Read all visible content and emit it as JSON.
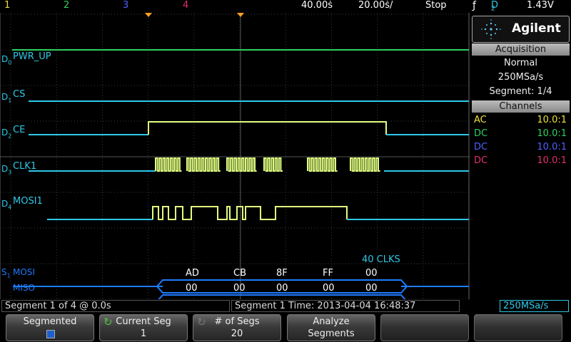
{
  "topbar": {
    "ch1": "1",
    "ch2": "2",
    "ch3": "3",
    "ch4": "4",
    "timebase": "40.00ṡ",
    "delay": "20.00ṡ/",
    "run_state": "Stop",
    "trigger_icon": "trigger-edge-icon",
    "trigger_source": "D",
    "trigger_source_sub": "2",
    "trigger_level": "1.43V"
  },
  "colors": {
    "ch1": "#f0e040",
    "ch2": "#30d060",
    "ch3": "#5060ff",
    "ch4": "#e03070",
    "digital": "#30c8e8",
    "high": "#e0ff80",
    "grid": "#404040",
    "serial": "#1e7cff",
    "orange": "#ffa020"
  },
  "channels": [
    {
      "id": "D",
      "sub": "0",
      "name": "PWR_UP"
    },
    {
      "id": "D",
      "sub": "1",
      "name": "CS"
    },
    {
      "id": "D",
      "sub": "2",
      "name": "CE"
    },
    {
      "id": "D",
      "sub": "3",
      "name": "CLK1"
    },
    {
      "id": "D",
      "sub": "4",
      "name": "MOSI1"
    }
  ],
  "serial": {
    "id": "S",
    "sub": "1",
    "annotation": "40 CLKS",
    "mosi_label": "MOSI",
    "miso_label": "MISO",
    "mosi_bytes": [
      "AD",
      "CB",
      "8F",
      "FF",
      "00"
    ],
    "miso_bytes": [
      "00",
      "00",
      "00",
      "00",
      "00"
    ]
  },
  "panel": {
    "brand": "Agilent",
    "acquisition_header": "Acquisition",
    "mode": "Normal",
    "sample_rate": "250MSa/s",
    "segment": "Segment: 1/4",
    "channels_header": "Channels",
    "channel_rows": [
      {
        "coupling": "AC",
        "ratio": "10.0:1"
      },
      {
        "coupling": "DC",
        "ratio": "10.0:1"
      },
      {
        "coupling": "DC",
        "ratio": "10.0:1"
      },
      {
        "coupling": "DC",
        "ratio": "10.0:1"
      }
    ]
  },
  "status": {
    "segment_info": "Segment   1 of    4 @ 0.0s",
    "segment_time": "Segment 1 Time: 2013-04-04 16:48:37",
    "sample_rate": "250MSa/s"
  },
  "softkeys": [
    {
      "label": "Segmented",
      "value": ""
    },
    {
      "label": "Current Seg",
      "value": "1"
    },
    {
      "label": "# of Segs",
      "value": "20"
    },
    {
      "label": "Analyze",
      "value": "Segments"
    }
  ]
}
